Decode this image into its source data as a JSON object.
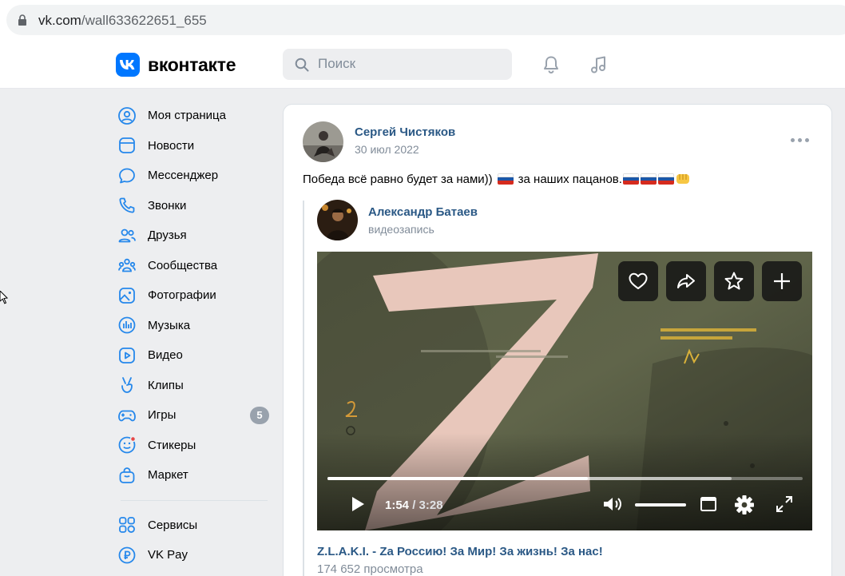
{
  "browser": {
    "url_domain": "vk.com",
    "url_path": "/wall633622651_655"
  },
  "header": {
    "logo_text": "вконтакте",
    "search_placeholder": "Поиск",
    "brand_color": "#0077ff"
  },
  "sidebar": {
    "items": [
      {
        "label": "Моя страница",
        "icon": "user-circle-icon"
      },
      {
        "label": "Новости",
        "icon": "newsfeed-icon"
      },
      {
        "label": "Мессенджер",
        "icon": "message-icon"
      },
      {
        "label": "Звонки",
        "icon": "phone-icon"
      },
      {
        "label": "Друзья",
        "icon": "users-icon"
      },
      {
        "label": "Сообщества",
        "icon": "communities-icon"
      },
      {
        "label": "Фотографии",
        "icon": "picture-icon"
      },
      {
        "label": "Музыка",
        "icon": "music-icon"
      },
      {
        "label": "Видео",
        "icon": "video-icon"
      },
      {
        "label": "Клипы",
        "icon": "clips-icon"
      },
      {
        "label": "Игры",
        "icon": "gamepad-icon",
        "badge": "5"
      },
      {
        "label": "Стикеры",
        "icon": "smile-icon"
      },
      {
        "label": "Маркет",
        "icon": "shopping-bag-icon"
      }
    ],
    "secondary_items": [
      {
        "label": "Сервисы",
        "icon": "services-icon"
      },
      {
        "label": "VK Pay",
        "icon": "vkpay-icon"
      }
    ]
  },
  "post": {
    "author": "Сергей Чистяков",
    "date": "30 июл 2022",
    "text": "Победа всё равно будет за нами))",
    "text_middle": "за наших пацанов.",
    "repost": {
      "author": "Александр Батаев",
      "subtitle": "видеозапись"
    },
    "video": {
      "current_time": "1:54",
      "separator": " / ",
      "duration": "3:28",
      "progress_fraction": 0.548,
      "buffered_fraction": 0.85,
      "volume_fraction": 1.0,
      "title": "Z.L.A.K.I. - Zа Россию! За Мир! За жизнь! За нас!",
      "views": "174 652 просмотра"
    }
  }
}
